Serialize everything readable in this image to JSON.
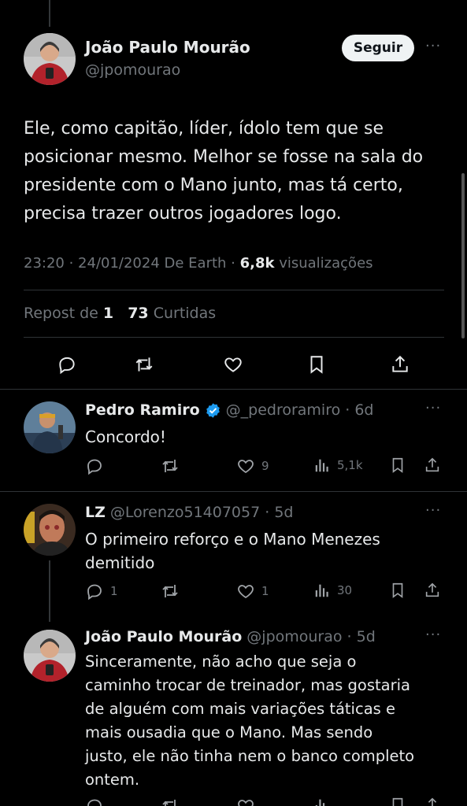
{
  "main_tweet": {
    "author_name": "João Paulo Mourão",
    "author_handle": "@jpomourao",
    "follow_label": "Seguir",
    "more": "···",
    "text_lines": [
      "Ele, como capitão, líder, ídolo tem que se",
      "posicionar mesmo. Melhor se fosse na sala do",
      "presidente com o Mano junto, mas tá certo,",
      "precisa trazer outros jogadores logo."
    ],
    "meta": {
      "time": "23:20 · 24/01/2024 De Earth ·",
      "views_count": "6,8k",
      "views_label": "visualizações"
    },
    "stats": {
      "repost_label": "Repost de",
      "repost_count": "1",
      "likes_count": "73",
      "likes_label": "Curtidas"
    }
  },
  "replies": [
    {
      "name": "Pedro Ramiro",
      "verified": true,
      "handle_time": "@_pedroramiro · 6d",
      "text_lines": [
        "Concordo!"
      ],
      "more": "···",
      "actions": {
        "reply": "",
        "retweet": "",
        "like": "9",
        "views": "5,1k"
      }
    },
    {
      "name": "LZ",
      "verified": false,
      "handle_time": "@Lorenzo51407057 · 5d",
      "text_lines": [
        "O primeiro reforço e o Mano Menezes",
        "demitido"
      ],
      "more": "···",
      "actions": {
        "reply": "1",
        "retweet": "",
        "like": "1",
        "views": "30"
      }
    },
    {
      "name": "João Paulo Mourão",
      "verified": false,
      "handle_time": "@jpomourao · 5d",
      "text_lines": [
        "Sinceramente, não acho que seja o",
        "caminho trocar de treinador, mas gostaria",
        "de alguém com mais variações táticas e",
        "mais ousadia que o Mano. Mas sendo",
        "justo, ele não tinha nem o banco completo",
        "ontem."
      ],
      "more": "···",
      "actions": {
        "reply": "",
        "retweet": "",
        "like": "",
        "views": ""
      }
    }
  ],
  "colors": {
    "background": "#000000",
    "text": "#e7e9ea",
    "muted": "#71767b",
    "divider": "#2f3336",
    "verified": "#1d9bf0"
  }
}
